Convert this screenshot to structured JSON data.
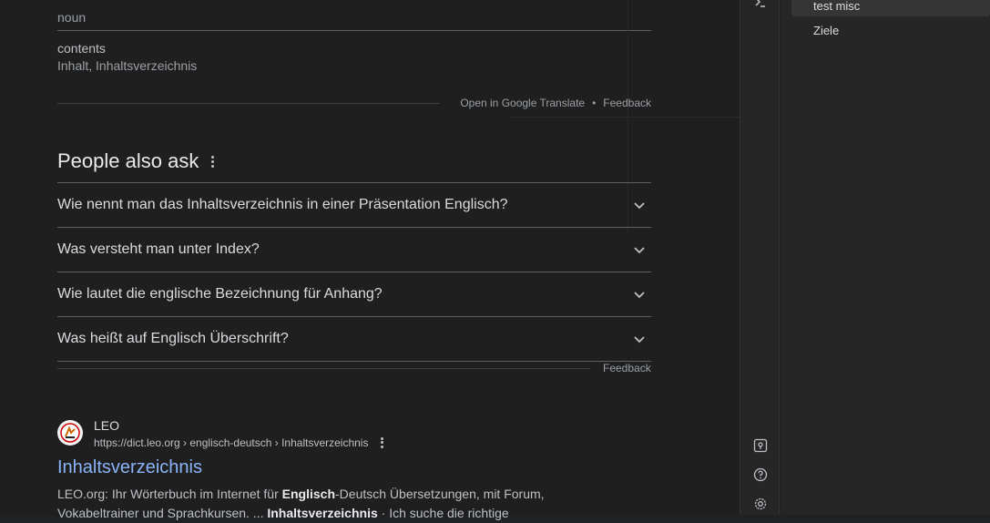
{
  "translate": {
    "pos": "noun",
    "word": "contents",
    "translation": "Inhalt, Inhaltsverzeichnis",
    "open_link": "Open in Google Translate",
    "separator": "•",
    "feedback": "Feedback"
  },
  "paa": {
    "title": "People also ask",
    "questions": [
      "Wie nennt man das Inhaltsverzeichnis in einer Präsentation Englisch?",
      "Was versteht man unter Index?",
      "Wie lautet die englische Bezeichnung für Anhang?",
      "Was heißt auf Englisch Überschrift?"
    ],
    "feedback": "Feedback"
  },
  "result": {
    "site_name": "LEO",
    "url": "https://dict.leo.org › englisch-deutsch › Inhaltsverzeichnis",
    "title": "Inhaltsverzeichnis",
    "snippet_1": "LEO.org: Ihr Wörterbuch im Internet für ",
    "snippet_b1": "Englisch",
    "snippet_2": "-Deutsch Übersetzungen, mit Forum, Vokabeltrainer und Sprachkursen. ... ",
    "snippet_b2": "Inhaltsverzeichnis",
    "snippet_3": " · Ich suche die richtige"
  },
  "sidebar": {
    "items": [
      "test misc",
      "Ziele"
    ]
  },
  "icons": {
    "terminal": "terminal-icon",
    "map_pin": "map-pin-icon",
    "help": "help-icon",
    "settings": "gear-icon"
  }
}
